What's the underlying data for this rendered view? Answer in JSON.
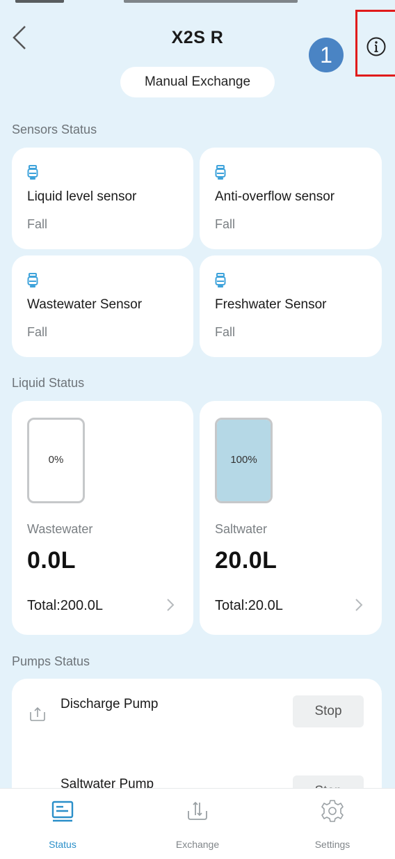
{
  "header": {
    "title": "X2S R",
    "step_badge": "1"
  },
  "manual_exchange": {
    "label": "Manual Exchange"
  },
  "sensors": {
    "section_title": "Sensors Status",
    "items": [
      {
        "name": "Liquid level sensor",
        "state": "Fall"
      },
      {
        "name": "Anti-overflow sensor",
        "state": "Fall"
      },
      {
        "name": "Wastewater Sensor",
        "state": "Fall"
      },
      {
        "name": "Freshwater Sensor",
        "state": "Fall"
      }
    ]
  },
  "liquid": {
    "section_title": "Liquid Status",
    "items": [
      {
        "name": "Wastewater",
        "percent_label": "0%",
        "fill_fraction": 0.0,
        "amount": "0.0L",
        "total": "Total:200.0L"
      },
      {
        "name": "Saltwater",
        "percent_label": "100%",
        "fill_fraction": 1.0,
        "amount": "20.0L",
        "total": "Total:20.0L"
      }
    ]
  },
  "pumps": {
    "section_title": "Pumps Status",
    "items": [
      {
        "name": "Discharge Pump",
        "action": "Stop",
        "icon": "upload-arrow-icon"
      },
      {
        "name": "Saltwater Pump",
        "action": "Stop",
        "icon": "download-arrow-icon"
      }
    ]
  },
  "tabs": [
    {
      "label": "Status",
      "icon": "status-icon",
      "active": true
    },
    {
      "label": "Exchange",
      "icon": "exchange-icon",
      "active": false
    },
    {
      "label": "Settings",
      "icon": "gear-icon",
      "active": false
    }
  ],
  "colors": {
    "background": "#e4f2fa",
    "accent": "#2a8fc9",
    "sensor_icon": "#3fa3db",
    "tank_fill": "#b5d8e6",
    "highlight_frame": "#e01b1b",
    "badge": "#4a84c4"
  }
}
